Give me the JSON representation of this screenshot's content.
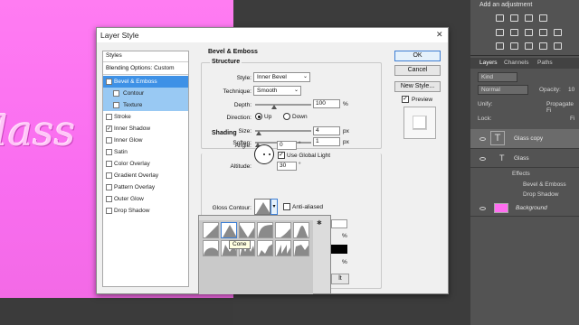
{
  "canvas": {
    "text": "lass"
  },
  "adjustments": {
    "title": "Add an adjustment"
  },
  "layers": {
    "tabs": [
      "Layers",
      "Channels",
      "Paths"
    ],
    "kind_label": "Kind",
    "blend_mode": "Normal",
    "opacity_label": "Opacity:",
    "opacity_value": "10",
    "unify_label": "Unify:",
    "propagate_label": "Propagate Fi",
    "lock_label": "Lock:",
    "fill_label": "Fi",
    "rows": [
      {
        "name": "Glass copy"
      },
      {
        "name": "Glass"
      },
      {
        "name": "Effects"
      },
      {
        "name": "Bevel & Emboss"
      },
      {
        "name": "Drop Shadow"
      },
      {
        "name": "Background"
      }
    ]
  },
  "dialog": {
    "title": "Layer Style",
    "close": "✕",
    "styles_header": "Styles",
    "blending": "Blending Options: Custom",
    "items": [
      {
        "label": "Bevel & Emboss",
        "checked": "✓"
      },
      {
        "label": "Contour",
        "checked": ""
      },
      {
        "label": "Texture",
        "checked": ""
      },
      {
        "label": "Stroke",
        "checked": ""
      },
      {
        "label": "Inner Shadow",
        "checked": "✓"
      },
      {
        "label": "Inner Glow",
        "checked": ""
      },
      {
        "label": "Satin",
        "checked": ""
      },
      {
        "label": "Color Overlay",
        "checked": ""
      },
      {
        "label": "Gradient Overlay",
        "checked": ""
      },
      {
        "label": "Pattern Overlay",
        "checked": ""
      },
      {
        "label": "Outer Glow",
        "checked": ""
      },
      {
        "label": "Drop Shadow",
        "checked": ""
      }
    ],
    "section_title": "Bevel & Emboss",
    "structure": {
      "title": "Structure",
      "style_label": "Style:",
      "style_value": "Inner Bevel",
      "technique_label": "Technique:",
      "technique_value": "Smooth",
      "depth_label": "Depth:",
      "depth_value": "100",
      "depth_unit": "%",
      "direction_label": "Direction:",
      "up": "Up",
      "down": "Down",
      "size_label": "Size:",
      "size_value": "4",
      "size_unit": "px",
      "soften_label": "Soften:",
      "soften_value": "1",
      "soften_unit": "px"
    },
    "shading": {
      "title": "Shading",
      "angle_label": "Angle:",
      "angle_value": "0",
      "angle_unit": "°",
      "global_light": "Use Global Light",
      "altitude_label": "Altitude:",
      "altitude_value": "30",
      "altitude_unit": "°",
      "gloss_label": "Gloss Contour:",
      "anti_aliased": "Anti-aliased",
      "pct1": "%",
      "pct2": "%"
    },
    "buttons": {
      "ok": "OK",
      "cancel": "Cancel",
      "new_style": "New Style...",
      "preview": "Preview",
      "reset_partial": "lt"
    },
    "picker": {
      "tooltip": "Cone",
      "gear": "✱"
    }
  }
}
